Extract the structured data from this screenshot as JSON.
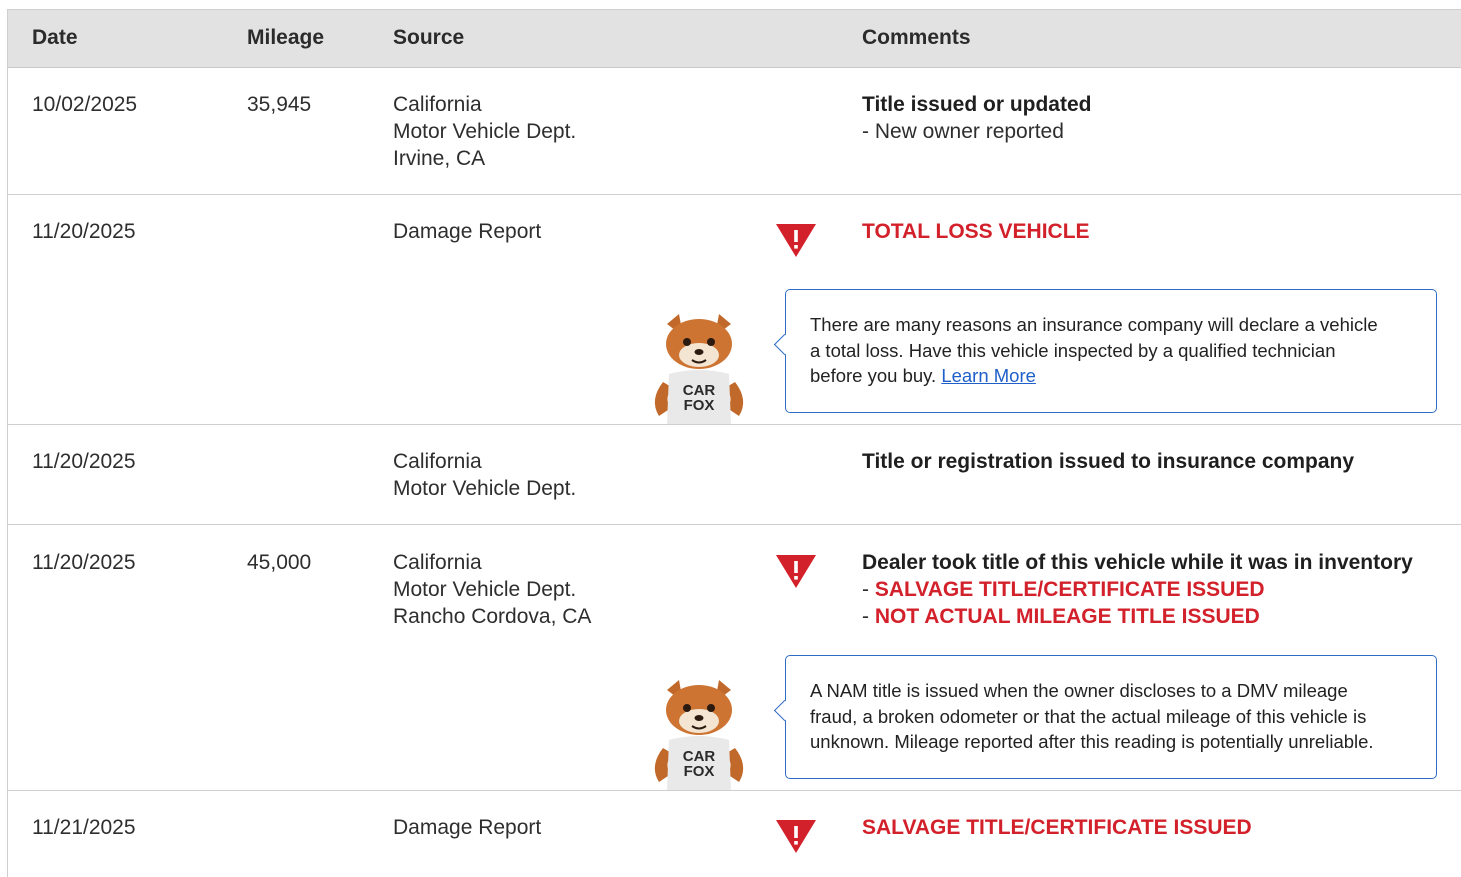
{
  "columns": {
    "date": "Date",
    "mileage": "Mileage",
    "source": "Source",
    "comments": "Comments"
  },
  "rows": [
    {
      "date": "10/02/2025",
      "mileage": "35,945",
      "source": [
        "California",
        "Motor Vehicle Dept.",
        "Irvine, CA"
      ],
      "comment_title": "Title issued or updated",
      "comment_lines": [
        "New owner reported"
      ]
    },
    {
      "date": "11/20/2025",
      "mileage": "",
      "source": [
        "Damage Report"
      ],
      "comment_title": "TOTAL LOSS VEHICLE",
      "callout": {
        "text": "There are many reasons an insurance company will declare a vehicle a total loss. Have this vehicle inspected by a qualified technician before you buy.",
        "line1": "There are many reasons an insurance company will declare a vehicle",
        "line2": "a total loss. Have this vehicle inspected by a qualified technician",
        "line3": "before you buy.",
        "link": "Learn More"
      }
    },
    {
      "date": "11/20/2025",
      "mileage": "",
      "source": [
        "California",
        "Motor Vehicle Dept."
      ],
      "comment_title": "Title or registration issued to insurance company"
    },
    {
      "date": "11/20/2025",
      "mileage": "45,000",
      "source": [
        "California",
        "Motor Vehicle Dept.",
        "Rancho Cordova, CA"
      ],
      "comment_title": "Dealer took title of this vehicle while it was in inventory",
      "comment_lines": [
        "SALVAGE TITLE/CERTIFICATE ISSUED",
        "NOT ACTUAL MILEAGE TITLE ISSUED"
      ],
      "callout": {
        "line1": "A NAM title is issued when the owner discloses to a DMV mileage",
        "line2": "fraud, a broken odometer or that the actual mileage of this vehicle is",
        "line3": "unknown. Mileage reported after this reading is potentially unreliable."
      }
    },
    {
      "date": "11/21/2025",
      "mileage": "",
      "source": [
        "Damage Report"
      ],
      "comment_title": "SALVAGE TITLE/CERTIFICATE ISSUED"
    }
  ],
  "mascot": {
    "shirt_line1": "CAR",
    "shirt_line2": "FOX"
  },
  "colors": {
    "alert_red": "#d3212b",
    "callout_border": "#2f6dc4",
    "link_blue": "#1f5fc9",
    "header_bg": "#e2e2e2"
  },
  "icons": {
    "warning": "warning-triangle-icon",
    "mascot": "carfox-mascot"
  }
}
